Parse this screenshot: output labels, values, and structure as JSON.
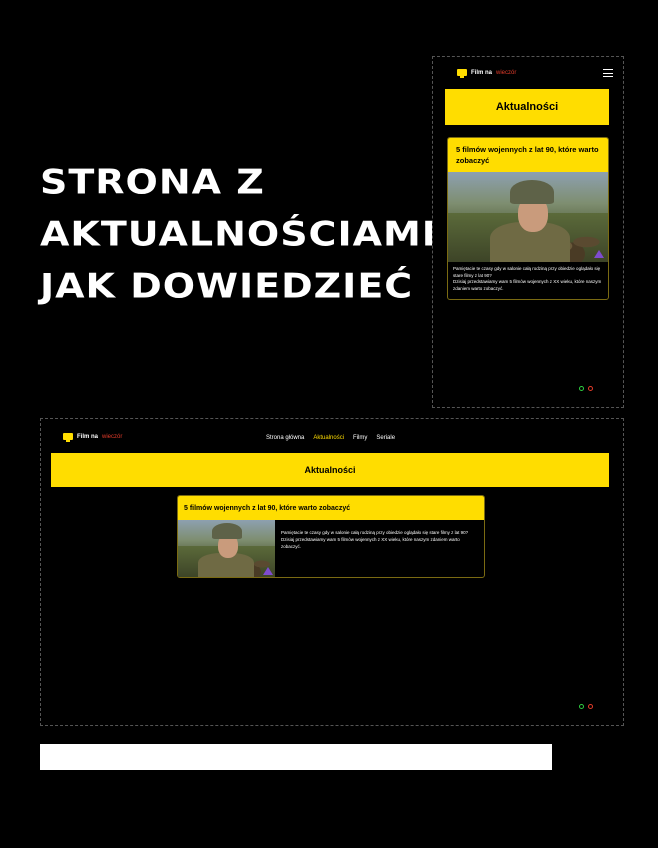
{
  "hero": {
    "lines": [
      "STRONA Z",
      "AKTUALNOŚCIAMI",
      "JAK DOWIEDZIEĆ"
    ]
  },
  "brand": {
    "name": "Film na",
    "accent": "wieczór"
  },
  "mobile": {
    "section_title": "Aktualności",
    "card": {
      "title": "5 filmów wojennych z lat 90, które warto zobaczyć",
      "text": "Pamiętacie te czasy gdy w salonie całą rodziną przy obiedzie oglądało się stare filmy z lat 90?",
      "text2": "Dzisiaj przedstawiamy wam 5 filmów wojennych z XX wieku, które naszym zdaniem warto zobaczyć."
    }
  },
  "desktop": {
    "nav": [
      "Strona główna",
      "Aktualności",
      "Filmy",
      "Seriale"
    ],
    "active_nav": "Aktualności",
    "section_title": "Aktualności",
    "card": {
      "title": "5 filmów wojennych z lat 90, które warto zobaczyć",
      "text": "Pamiętacie te czasy gdy w salonie całą rodziną przy obiedzie oglądało się stare filmy z lat 90?",
      "text2": "Dzisiaj przedstawiamy wam 5 filmów wojennych z XX wieku, które naszym zdaniem warto zobaczyć."
    }
  },
  "colors": {
    "accent": "#ffdd00",
    "brand_red": "#e23b2a",
    "green": "#2ecc40"
  },
  "icons": [
    "tv-logo-icon",
    "hamburger-menu-icon"
  ]
}
